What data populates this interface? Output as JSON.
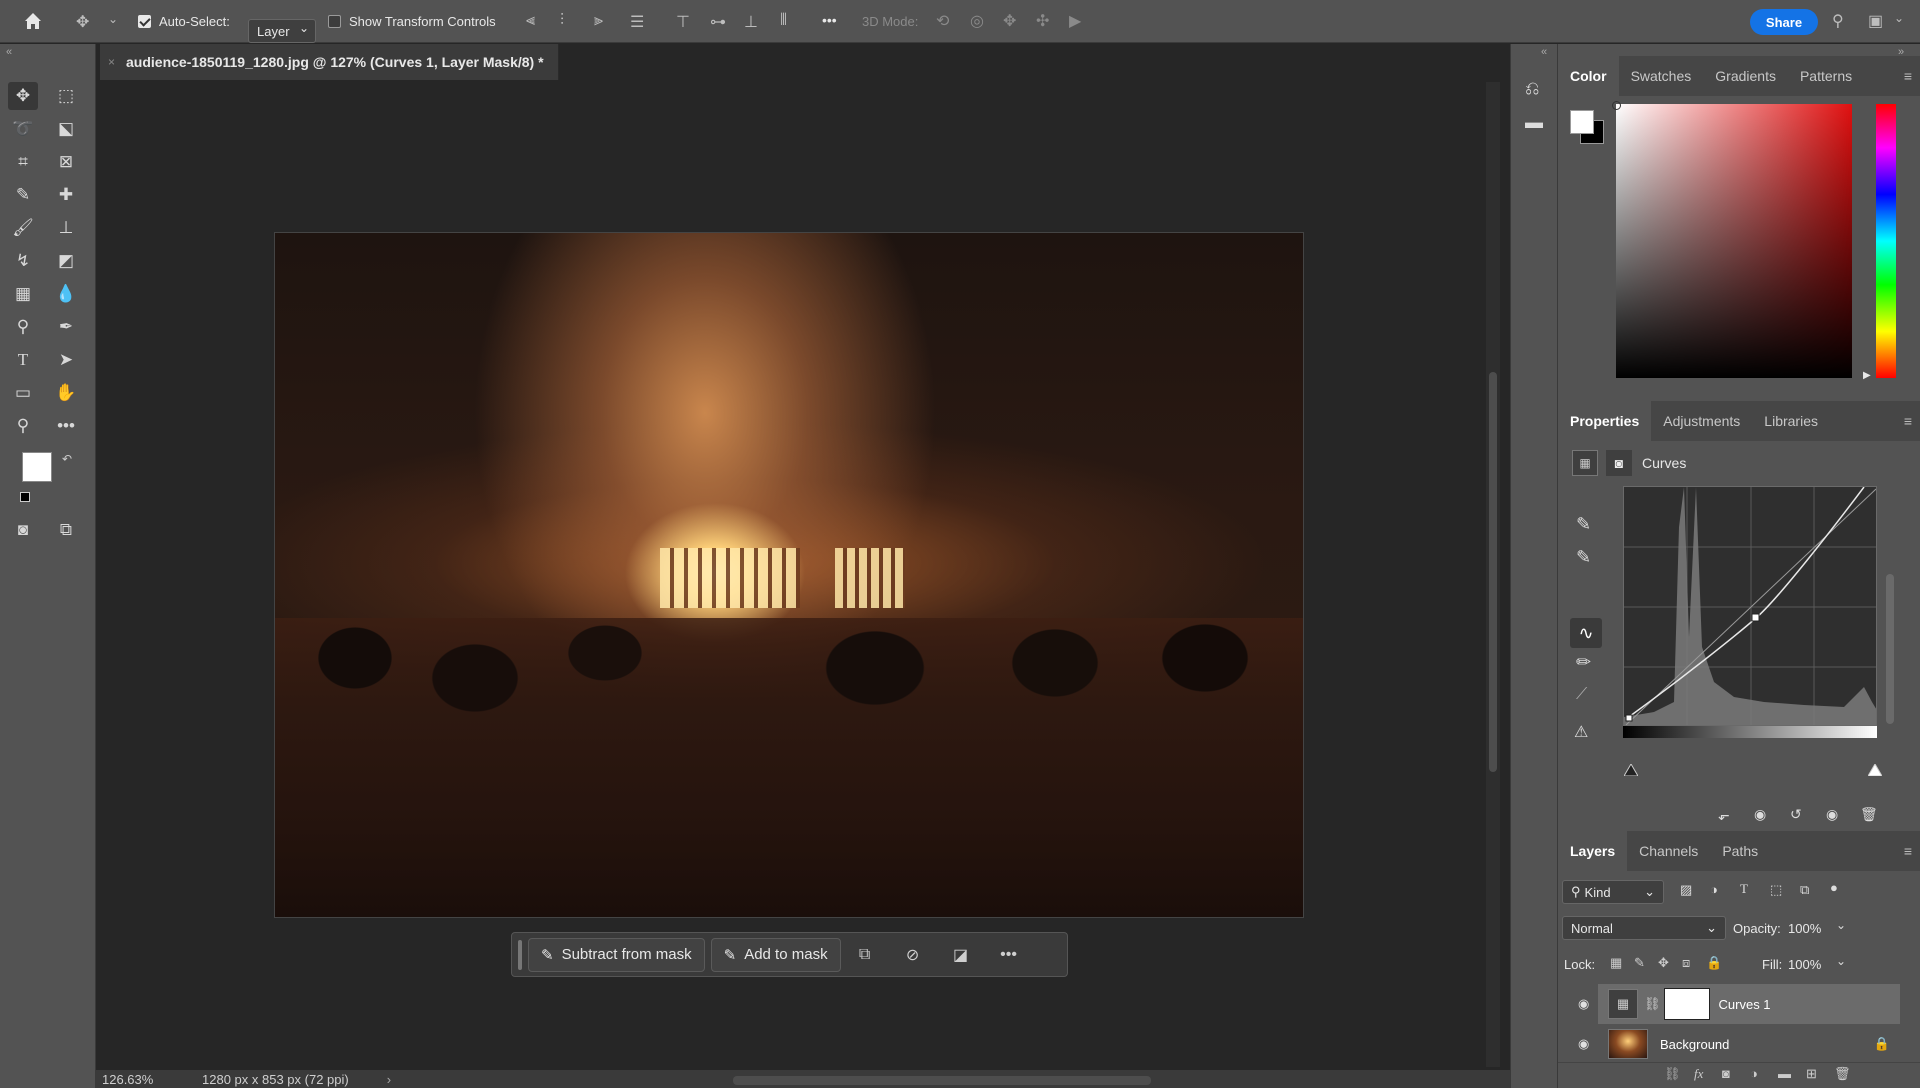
{
  "options_bar": {
    "home_icon": "home-icon",
    "auto_select_label": "Auto-Select:",
    "auto_select_checked": true,
    "auto_select_value": "Layer",
    "transform_controls_label": "Show Transform Controls",
    "transform_controls_checked": false,
    "mode_3d_label": "3D Mode:",
    "more_label": "•••",
    "share_label": "Share"
  },
  "document": {
    "tab_title": "audience-1850119_1280.jpg @ 127% (Curves 1, Layer Mask/8) *",
    "zoom": "126.63%",
    "dimensions": "1280 px x 853 px (72 ppi)"
  },
  "mask_bar": {
    "subtract_label": "Subtract from mask",
    "add_label": "Add to mask",
    "more_label": "•••"
  },
  "color_panel": {
    "tabs": [
      "Color",
      "Swatches",
      "Gradients",
      "Patterns"
    ],
    "active_tab": "Color",
    "hue_color": "#e01010"
  },
  "properties_panel": {
    "tabs": [
      "Properties",
      "Adjustments",
      "Libraries"
    ],
    "active_tab": "Properties",
    "adjustment_name": "Curves"
  },
  "layers_panel": {
    "tabs": [
      "Layers",
      "Channels",
      "Paths"
    ],
    "active_tab": "Layers",
    "filter_kind": "Kind",
    "blend_mode": "Normal",
    "opacity_label": "Opacity:",
    "opacity_value": "100%",
    "lock_label": "Lock:",
    "fill_label": "Fill:",
    "fill_value": "100%",
    "layers": [
      {
        "name": "Curves 1",
        "visible": true,
        "selected": true
      },
      {
        "name": "Background",
        "visible": true,
        "locked": true
      }
    ]
  },
  "colors": {
    "accent": "#1473e6",
    "panel_bg": "#535353",
    "canvas_bg": "#262626"
  }
}
